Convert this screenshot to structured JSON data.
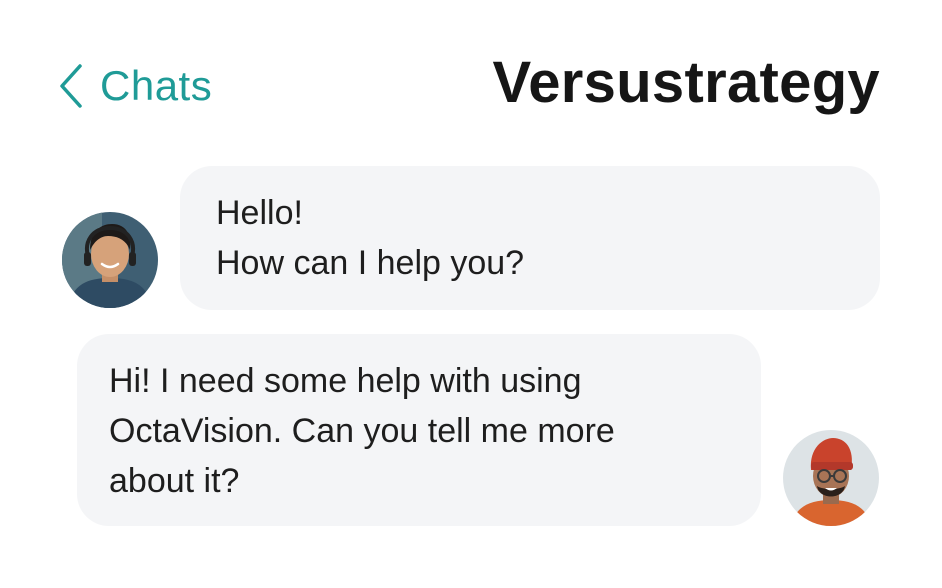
{
  "header": {
    "back_label": "Chats",
    "back_icon": "chevron-left-icon",
    "title": "Versustrategy"
  },
  "messages": [
    {
      "sender": "agent",
      "lines": [
        "Hello!",
        "How can I help you?"
      ]
    },
    {
      "sender": "user",
      "lines": [
        "Hi! I need some help with using",
        "OctaVision. Can you tell me more",
        "about it?"
      ]
    }
  ],
  "colors": {
    "accent": "#1f9b97",
    "bubble": "#f4f5f7",
    "text": "#1e1e1e",
    "background": "#ffffff"
  }
}
